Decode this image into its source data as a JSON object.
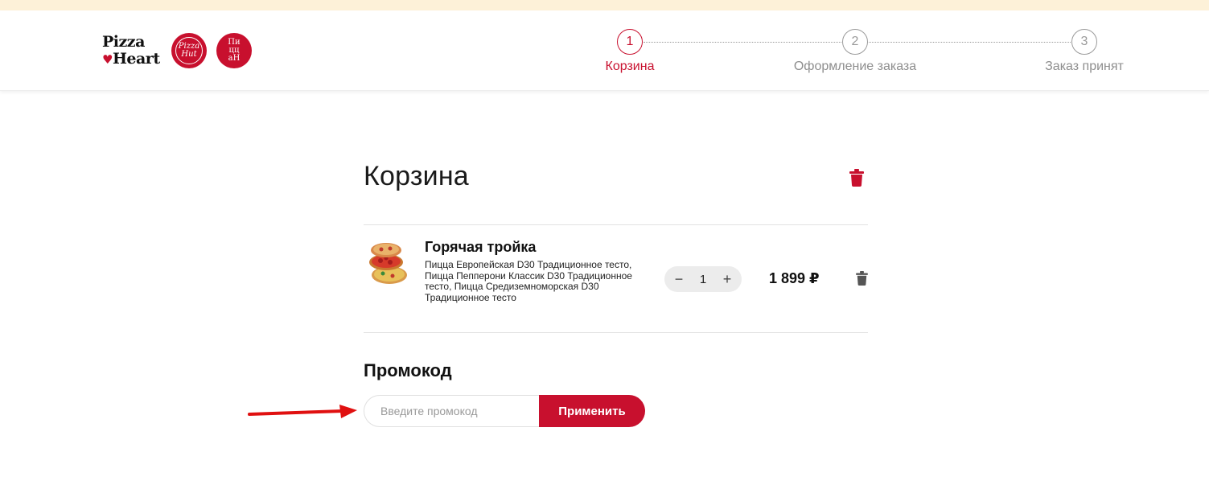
{
  "brand": {
    "logo_line1": "Pizza",
    "logo_line2": "Heart",
    "badge_hut": "Pizza Hut",
    "badge_tsh_line1": "Пи",
    "badge_tsh_line2": "цц",
    "badge_tsh_line3": "аН"
  },
  "steps": [
    {
      "number": "1",
      "label": "Корзина",
      "active": true
    },
    {
      "number": "2",
      "label": "Оформление заказа",
      "active": false
    },
    {
      "number": "3",
      "label": "Заказ принят",
      "active": false
    }
  ],
  "cart": {
    "title": "Корзина",
    "items": [
      {
        "name": "Горячая тройка",
        "description": "Пицца Европейская D30 Традиционное тесто, Пицца Пепперони Классик D30 Традиционное тесто, Пицца Средиземноморская D30 Традиционное тесто",
        "quantity": "1",
        "decrement": "−",
        "increment": "+",
        "price": "1 899 ₽"
      }
    ]
  },
  "promo": {
    "title": "Промокод",
    "placeholder": "Введите промокод",
    "value": "",
    "apply_label": "Применить"
  },
  "colors": {
    "accent": "#c8102e",
    "top_strip": "#fdf1d8",
    "annotation_arrow": "#e01010"
  },
  "icons": {
    "clear_cart": "trash-icon",
    "remove_item": "trash-icon",
    "annotation": "arrow-right-icon"
  }
}
